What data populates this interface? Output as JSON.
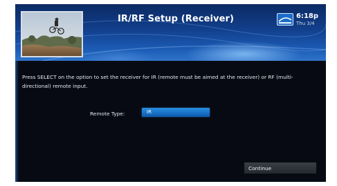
{
  "header": {
    "title": "IR/RF Setup (Receiver)",
    "time": "6:18p",
    "date": "Thu 3/4"
  },
  "main": {
    "instructions": "Press SELECT on the option to set the receiver for IR (remote must be aimed at the receiver) or RF (multi-directional) remote input.",
    "remote_type_label": "Remote Type:",
    "remote_type_value": "IR",
    "continue_label": "Continue"
  },
  "colors": {
    "header_blue": "#123f8c",
    "selection_blue": "#1670c6",
    "background": "#070a12"
  },
  "icons": {
    "channel_logo": "tv-logo-icon"
  }
}
